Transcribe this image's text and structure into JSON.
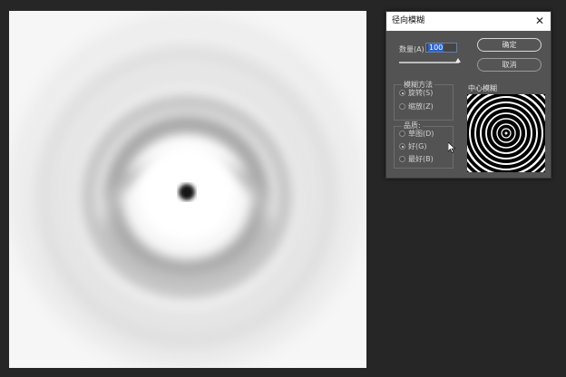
{
  "dialog": {
    "title": "径向模糊",
    "close_glyph": "✕",
    "amount_label": "数量(A)",
    "amount_value": "100",
    "amount_slider_fraction": 1.0,
    "ok_label": "确定",
    "cancel_label": "取消",
    "blur_method": {
      "label": "模糊方法",
      "options": [
        {
          "label": "旋转(S)",
          "selected": true
        },
        {
          "label": "缩放(Z)",
          "selected": false
        }
      ]
    },
    "quality": {
      "label": "品质:",
      "options": [
        {
          "label": "草图(D)",
          "selected": false
        },
        {
          "label": "好(G)",
          "selected": true
        },
        {
          "label": "最好(B)",
          "selected": false
        }
      ]
    },
    "center_label": "中心模糊"
  },
  "colors": {
    "workspace_bg": "#262626",
    "dialog_bg": "#535353",
    "title_bg": "#ffffff",
    "selection_blue": "#2d62c8"
  },
  "icons": {
    "close": "close-icon",
    "cursor": "mouse-pointer-icon"
  }
}
